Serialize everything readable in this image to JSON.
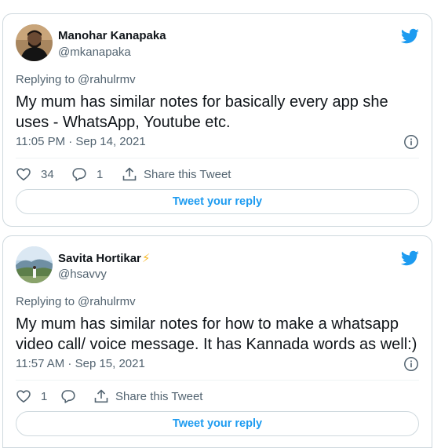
{
  "colors": {
    "twitter_blue": "#1d9bf0",
    "secondary_text": "#536471",
    "border": "#cfd9de"
  },
  "tweets": [
    {
      "display_name": "Manohar Kanapaka",
      "handle": "@mkanapaka",
      "badge": "",
      "replying_prefix": "Replying to",
      "replying_to": "@rahulrmv",
      "text": "My mum has similar notes for basically every app she uses - WhatsApp, Youtube etc.",
      "timestamp": "11:05 PM · Sep 14, 2021",
      "likes": "34",
      "replies": "1",
      "share_label": "Share this Tweet",
      "reply_button_label": "Tweet your reply",
      "icons": {
        "brand": "twitter-bird-icon",
        "info": "info-icon",
        "like": "heart-icon",
        "reply": "reply-bubble-icon",
        "share": "share-icon"
      }
    },
    {
      "display_name": "Savita Hortikar",
      "handle": "@hsavvy",
      "badge": "⚡",
      "replying_prefix": "Replying to",
      "replying_to": "@rahulrmv",
      "text": "My mum has similar notes for how to make a whatsapp video call/ voice message. It has Kannada words as well:)",
      "timestamp": "11:57 AM · Sep 15, 2021",
      "likes": "1",
      "replies": "",
      "share_label": "Share this Tweet",
      "reply_button_label": "Tweet your reply",
      "icons": {
        "brand": "twitter-bird-icon",
        "info": "info-icon",
        "like": "heart-icon",
        "reply": "reply-bubble-icon",
        "share": "share-icon"
      }
    }
  ]
}
